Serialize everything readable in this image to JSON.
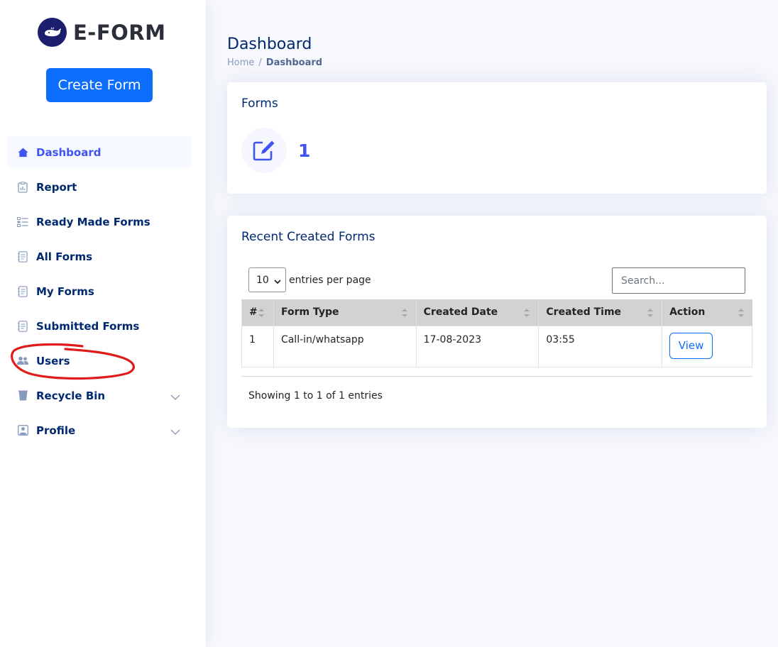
{
  "brand": {
    "name": "E-FORM"
  },
  "sidebar": {
    "create_label": "Create Form",
    "items": [
      {
        "label": "Dashboard",
        "icon": "house-icon",
        "active": true
      },
      {
        "label": "Report",
        "icon": "clipboard-data-icon"
      },
      {
        "label": "Ready Made Forms",
        "icon": "list-check-icon"
      },
      {
        "label": "All Forms",
        "icon": "journal-text-icon"
      },
      {
        "label": "My Forms",
        "icon": "journal-text-icon"
      },
      {
        "label": "Submitted Forms",
        "icon": "journal-text-icon"
      },
      {
        "label": "Users",
        "icon": "people-icon"
      },
      {
        "label": "Recycle Bin",
        "icon": "trash-icon",
        "expandable": true
      },
      {
        "label": "Profile",
        "icon": "person-square-icon",
        "expandable": true
      }
    ]
  },
  "page": {
    "title": "Dashboard",
    "breadcrumb": [
      "Home",
      "Dashboard"
    ]
  },
  "forms_card": {
    "title": "Forms",
    "count": "1"
  },
  "recent": {
    "title": "Recent Created Forms",
    "per_page_value": "10",
    "per_page_label": "entries per page",
    "search_placeholder": "Search...",
    "columns": [
      "#",
      "Form Type",
      "Created Date",
      "Created Time",
      "Action"
    ],
    "rows": [
      {
        "num": "1",
        "form_type": "Call-in/whatsapp",
        "date": "17-08-2023",
        "time": "03:55",
        "action": "View"
      }
    ],
    "footer": "Showing 1 to 1 of 1 entries"
  },
  "colors": {
    "accent": "#4154f1",
    "primary_button": "#0d6efd",
    "nav_text": "#012970",
    "annotation": "#e01b1b"
  }
}
